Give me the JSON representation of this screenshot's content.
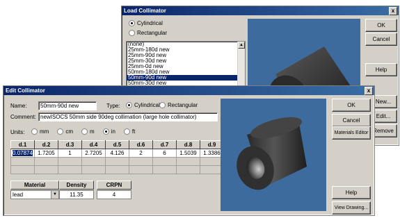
{
  "load_dialog": {
    "title": "Load Collimator",
    "close": "x",
    "radio_cylindrical": "Cylindrical",
    "radio_rectangular": "Rectangular",
    "list_items": [
      "(none)",
      "25mm-180d new",
      "25mm-90d new",
      "25mm-30d new",
      "25mm-0d new",
      "50mm-180d new",
      "50mm-90d new",
      "50mm-30d new"
    ],
    "selected_index": 6,
    "buttons": {
      "ok": "OK",
      "cancel": "Cancel",
      "help": "Help",
      "new": "New...",
      "edit": "Edit...",
      "remove": "Remove"
    }
  },
  "edit_dialog": {
    "title": "Edit Collimator",
    "close": "x",
    "name_label": "Name:",
    "name_value": "50mm-90d new",
    "type_label": "Type:",
    "type_cylindrical": "Cylindrical",
    "type_rectangular": "Rectangular",
    "comment_label": "Comment:",
    "comment_value": "newISOCS 50mm side 90deg collimation (large hole collimator)",
    "units_label": "Units:",
    "units": [
      "mm",
      "cm",
      "m",
      "in",
      "ft"
    ],
    "selected_unit": "in",
    "grid_headers": [
      "d.1",
      "d.2",
      "d.3",
      "d.4",
      "d.5",
      "d.6",
      "d.7",
      "d.8",
      "d.9"
    ],
    "grid_values": [
      "0.07874",
      "1.7205",
      "1",
      "2.7205",
      "4.126",
      "2",
      "6",
      "1.5039",
      "1.3386"
    ],
    "material_header": "Material",
    "density_header": "Density",
    "crpn_header": "CRPN",
    "material_value": "lead",
    "density_value": "11.35",
    "crpn_value": "4",
    "buttons": {
      "ok": "OK",
      "cancel": "Cancel",
      "materials_editor": "Materials Editor",
      "help": "Help",
      "view_drawing": "View Drawing..."
    }
  },
  "colors": {
    "title_start": "#0a246a",
    "title_end": "#3a6ea5",
    "preview_bg": "#3d6b9e",
    "selection": "#0a246a"
  }
}
